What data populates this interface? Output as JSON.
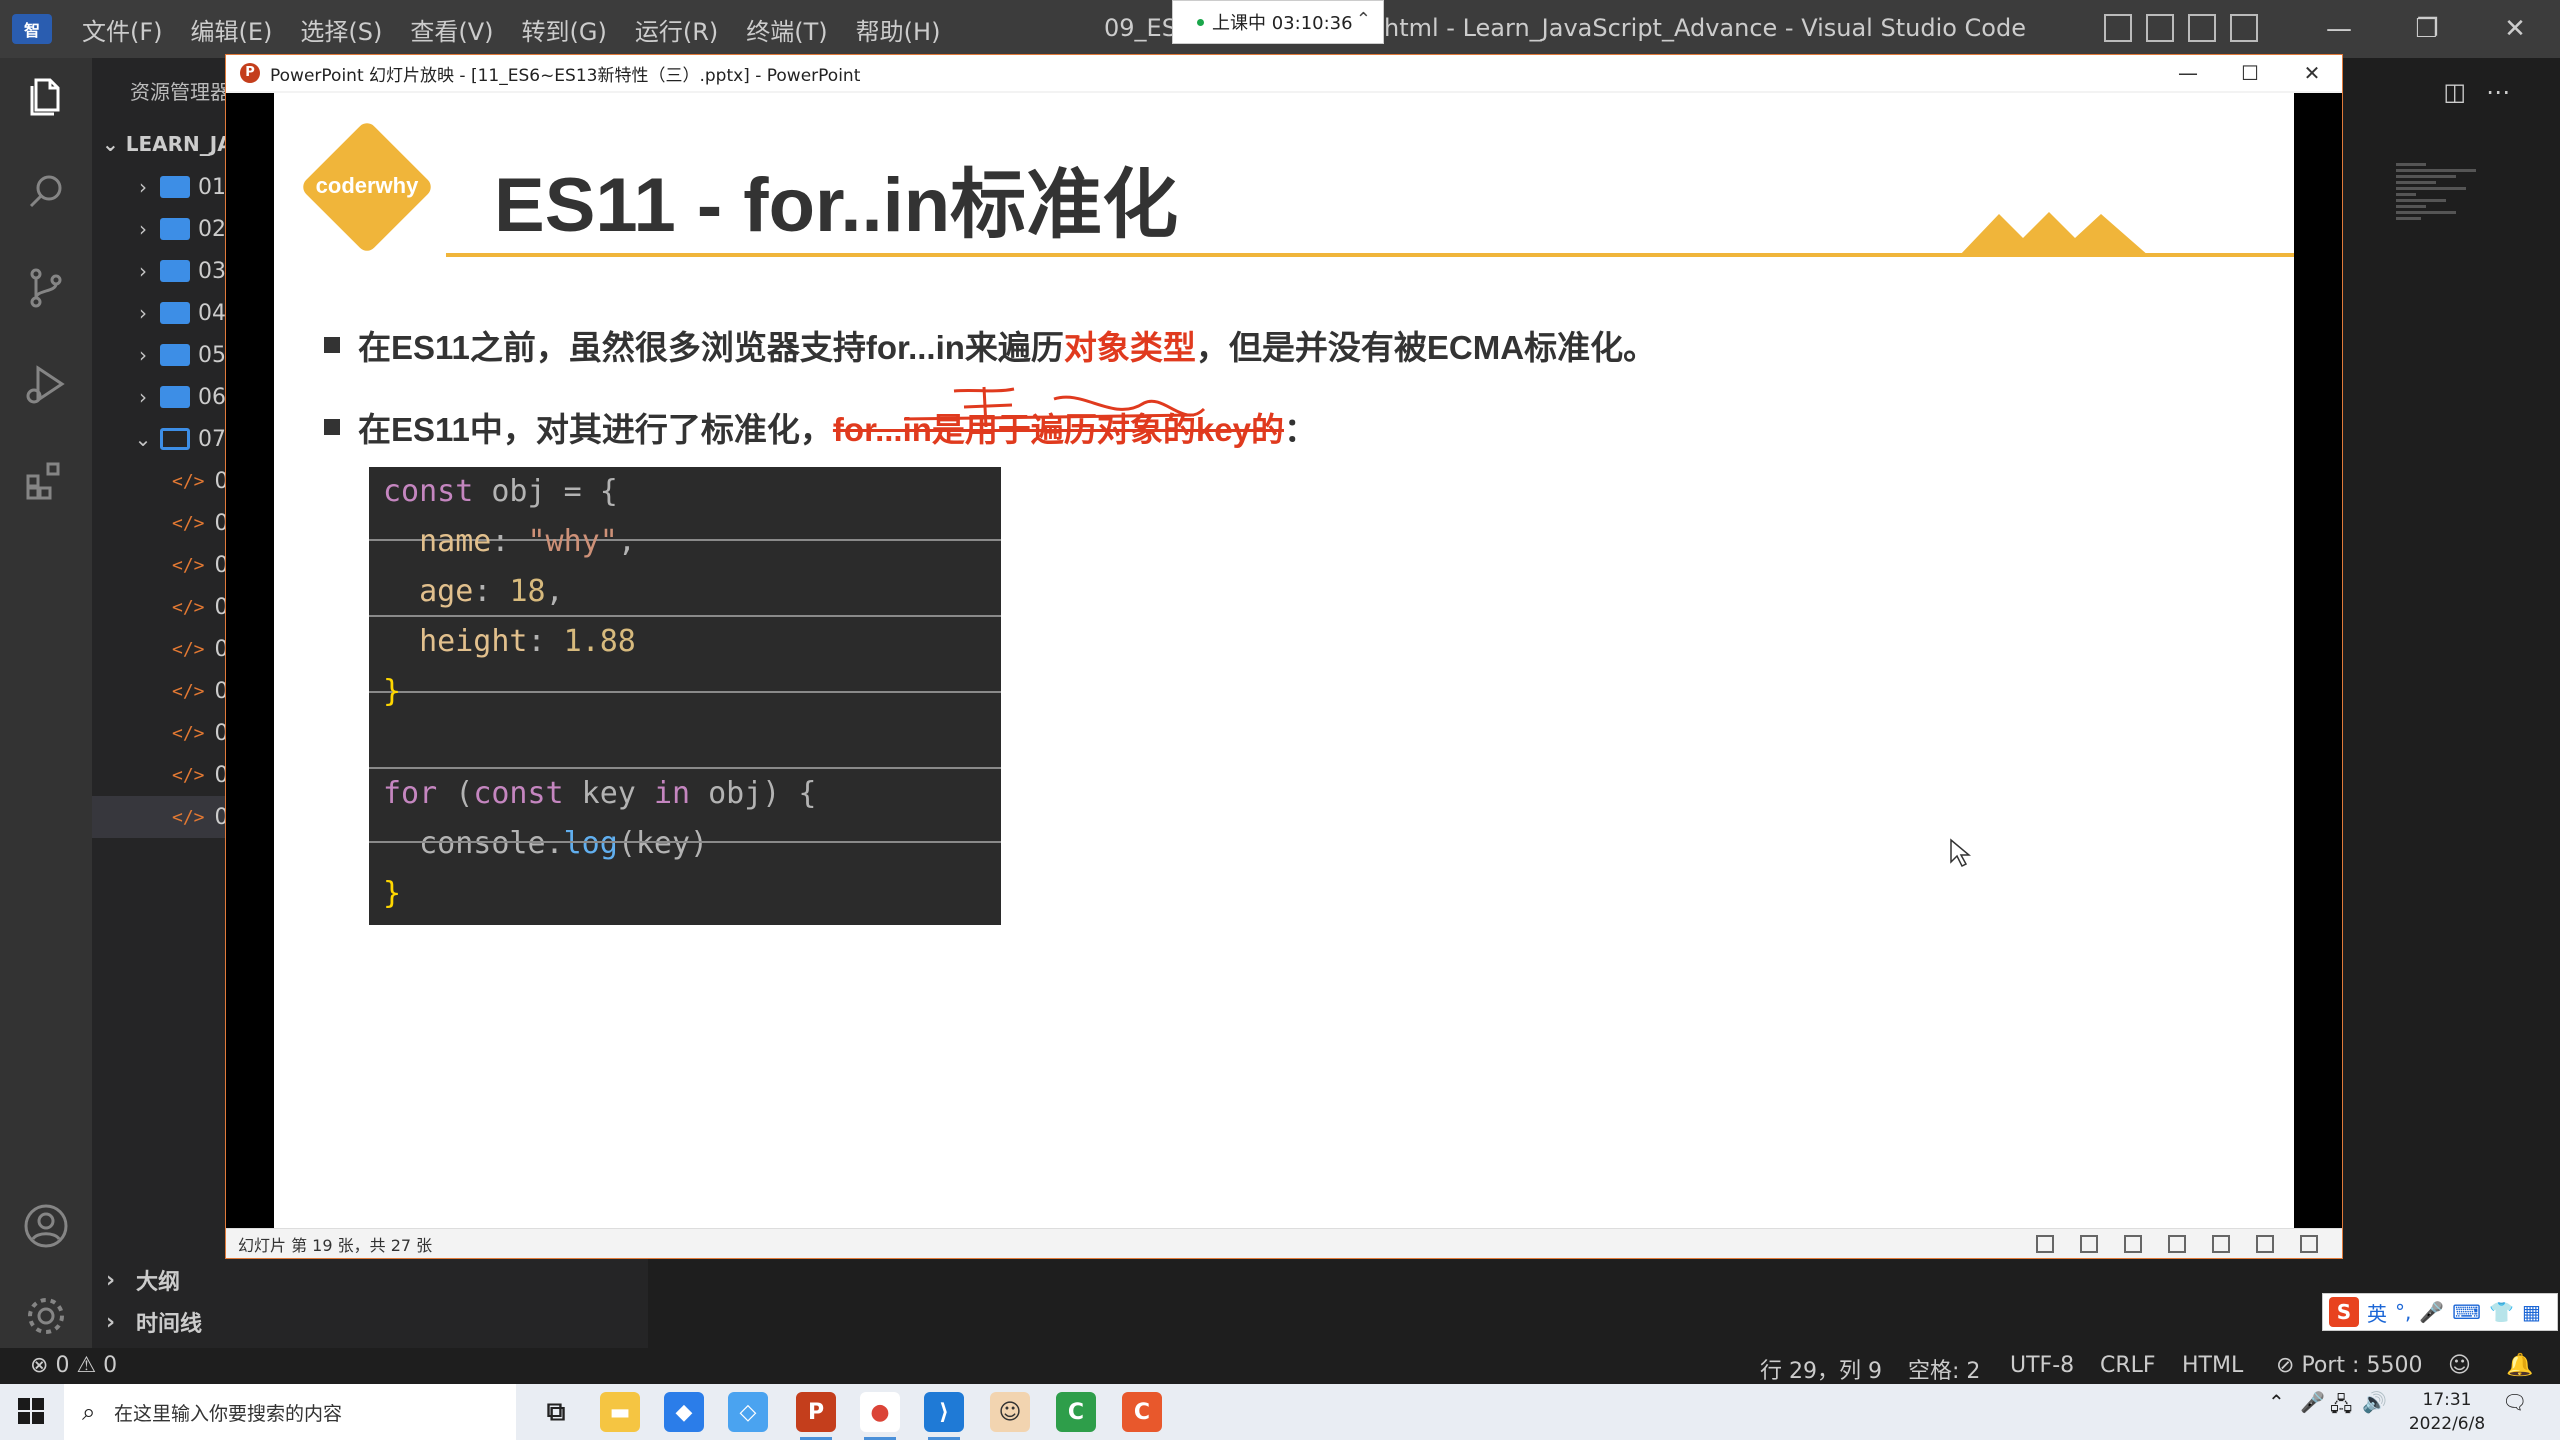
{
  "vscode": {
    "menu": [
      "文件(F)",
      "编辑(E)",
      "选择(S)",
      "查看(V)",
      "转到(G)",
      "运行(R)",
      "终端(T)",
      "帮助(H)"
    ],
    "title_prefix": "09_ES1",
    "title_suffix": "html - Learn_JavaScript_Advance - Visual Studio Code",
    "recording_label": "上课中 03:10:36",
    "explorer_title": "资源管理器",
    "root_folder": "LEARN_JA",
    "folders": [
      "01",
      "02",
      "03",
      "04",
      "05",
      "06",
      "07"
    ],
    "files": [
      "0",
      "0",
      "0",
      "0",
      "0",
      "0",
      "0",
      "0",
      "0"
    ],
    "file_tag": "</>",
    "panels": [
      "大纲",
      "时间线"
    ]
  },
  "ppt": {
    "window_title": "PowerPoint 幻灯片放映 - [11_ES6~ES13新特性（三）.pptx] - PowerPoint",
    "status": "幻灯片 第 19 张，共 27 张",
    "slide": {
      "badge": "coderwhy",
      "title": "ES11 - for..in标准化",
      "bullet1_pre": "在ES11之前，虽然很多浏览器支持for...in来遍历",
      "bullet1_red": "对象类型",
      "bullet1_post": "，但是并没有被ECMA标准化。",
      "bullet2_pre": "在ES11中，对其进行了标准化，",
      "bullet2_red": "for...in是用于遍历对象的key的",
      "bullet2_post": "：",
      "code": {
        "l1_kw": "const",
        "l1_rest": " obj = {",
        "l2_key": "name",
        "l2_val": "\"why\"",
        "l3_key": "age",
        "l3_val": "18",
        "l4_key": "height",
        "l4_val": "1.88",
        "l5": "}",
        "l7_kw1": "for",
        "l7_mid1": " (",
        "l7_kw2": "const",
        "l7_mid2": " key ",
        "l7_kw3": "in",
        "l7_mid3": " obj) {",
        "l8_obj": "console.",
        "l8_fn": "log",
        "l8_arg": "(key)",
        "l9": "}"
      }
    }
  },
  "statusbar": {
    "errors": "0",
    "warnings": "0",
    "position": "行 29，列 9",
    "spaces": "空格: 2",
    "encoding": "UTF-8",
    "eol": "CRLF",
    "language": "HTML",
    "port": "Port : 5500"
  },
  "ime": {
    "lang": "英"
  },
  "taskbar": {
    "search_placeholder": "在这里输入你要搜索的内容",
    "time": "17:31",
    "date": "2022/6/8"
  },
  "colors": {
    "accent_orange": "#f0b53a",
    "highlight_red": "#e03a1e",
    "vscode_blue": "#3d8ee6"
  }
}
